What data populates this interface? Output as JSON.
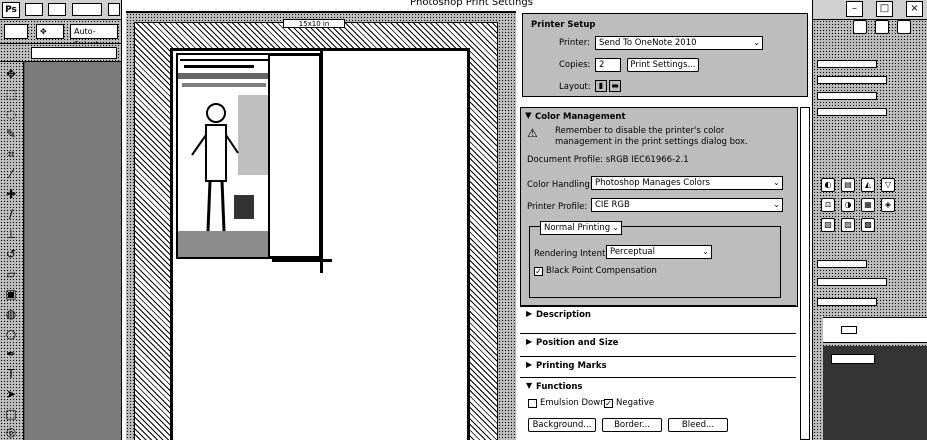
{
  "photoshop": {
    "logo": "Ps",
    "menu_items": [
      "",
      "",
      "",
      ""
    ],
    "window_buttons": [
      "",
      "",
      ""
    ],
    "options": {
      "left_btn": "",
      "auto_select": "Auto-Select"
    }
  },
  "dialog": {
    "title": "Photoshop Print Settings",
    "preview_label": "15x10 in",
    "printer_setup": {
      "heading": "Printer Setup",
      "printer_label": "Printer:",
      "printer_value": "Send To OneNote 2010",
      "copies_label": "Copies:",
      "copies_value": "2",
      "print_settings_btn": "Print Settings...",
      "layout_label": "Layout:"
    },
    "color_management": {
      "heading": "Color Management",
      "warning_line1": "Remember to disable the printer's color",
      "warning_line2": "management in the print settings dialog box.",
      "document_profile": "Document Profile: sRGB IEC61966-2.1",
      "color_handling_label": "Color Handling:",
      "color_handling_value": "Photoshop Manages Colors",
      "printer_profile_label": "Printer Profile:",
      "printer_profile_value": "CIE RGB",
      "normal_printing": "Normal Printing",
      "rendering_intent_label": "Rendering Intent:",
      "rendering_intent_value": "Perceptual",
      "black_point_label": "Black Point Compensation",
      "black_point_checked": true
    },
    "sections": {
      "description": "Description",
      "position_size": "Position and Size",
      "printing_marks": "Printing Marks",
      "functions": "Functions"
    },
    "functions": {
      "emulsion_down_label": "Emulsion Down",
      "emulsion_down_checked": false,
      "negative_label": "Negative",
      "negative_checked": true,
      "background_btn": "Background...",
      "border_btn": "Border...",
      "bleed_btn": "Bleed..."
    }
  }
}
